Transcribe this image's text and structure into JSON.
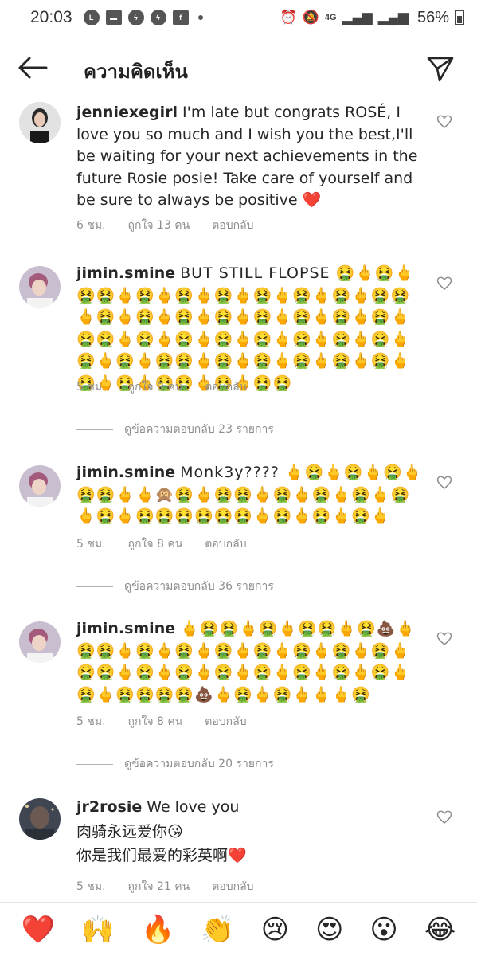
{
  "status_bar": {
    "time": "20:03",
    "battery": "56%",
    "network": "4G"
  },
  "header": {
    "title": "ความคิดเห็น"
  },
  "comments": [
    {
      "username": "jenniexegirl",
      "text": "I'm late but congrats ROSÉ, I love you so much and I wish you the best,I'll be waiting for your next achievements in the future Rosie posie! Take care of yourself and be sure to always be positive ❤️",
      "time": "6 ชม.",
      "likes": "ถูกใจ 13 คน",
      "reply": "ตอบกลับ",
      "avatar_color": "#d6d6d6"
    },
    {
      "username": "jimin.smine",
      "text": "BUT STILL FLOPSE 🤮🖕🤮🖕🤮🤮🖕🤮🖕🤮🖕🤮🖕🤮🖕🤮🖕🤮🖕🤮🤮🖕🤮🖕🤮🖕🤮🖕🤮🖕🤮🖕🤮🖕🤮🖕🤮🖕🤮🤮🖕🤮🖕🤮🖕🤮🖕🤮🖕🤮🖕🤮🖕🤮🖕🤮🖕🤮🖕🤮🤮🖕🤮🖕🤮🖕🤮🖕🤮🖕🤮🖕🤮🖕🤮🖕🤮🤮🖕🤮🖕🤮🤮",
      "time": "5 ชม.",
      "likes": "ถูกใจ 9 คน",
      "reply": "ตอบกลับ",
      "view_replies": "ดูข้อความตอบกลับ 23 รายการ",
      "avatar_color": "#b7a3c0"
    },
    {
      "username": "jimin.smine",
      "text": "Monk3y???? 🖕🤮🖕🤮🖕🤮🖕🤮🤮🖕🖕🙊🤮🖕🤮🤮🖕🤮🖕🤮🖕🤮🖕🤮🖕🤮🖕🤮🤮🤮🤮🤮🤮🖕🤮🖕🤮🖕🤮🖕",
      "time": "5 ชม.",
      "likes": "ถูกใจ 8 คน",
      "reply": "ตอบกลับ",
      "view_replies": "ดูข้อความตอบกลับ 36 รายการ",
      "avatar_color": "#b7a3c0"
    },
    {
      "username": "jimin.smine",
      "text": "🖕🤮🤮🖕🤮🖕🤮🤮🖕🤮💩🖕🤮🤮🖕🤮🖕🤮🖕🤮🖕🤮🖕🤮🖕🤮🖕🤮🖕🤮🤮🖕🤮🖕🤮🖕🤮🖕🤮🖕🤮🖕🤮🖕🤮🖕🤮🖕🤮🤮🤮🤮💩🖕🤮🖕🤮🖕🖕🖕🤮",
      "time": "5 ชม.",
      "likes": "ถูกใจ 8 คน",
      "reply": "ตอบกลับ",
      "view_replies": "ดูข้อความตอบกลับ 20 รายการ",
      "avatar_color": "#b7a3c0"
    },
    {
      "username": "jr2rosie",
      "text": "We love you",
      "text_line2": "肉骑永远爱你😘",
      "text_line3": "你是我们最爱的彩英啊❤️",
      "time": "5 ชม.",
      "likes": "ถูกใจ 21 คน",
      "reply": "ตอบกลับ",
      "avatar_color": "#5b6270"
    }
  ],
  "emoji_bar": [
    "❤️",
    "🙌",
    "🔥",
    "👏",
    "😢",
    "😍",
    "😮",
    "😂"
  ],
  "colors": {
    "text_primary": "#262626",
    "text_secondary": "#8e8e8e",
    "background": "#ffffff"
  }
}
